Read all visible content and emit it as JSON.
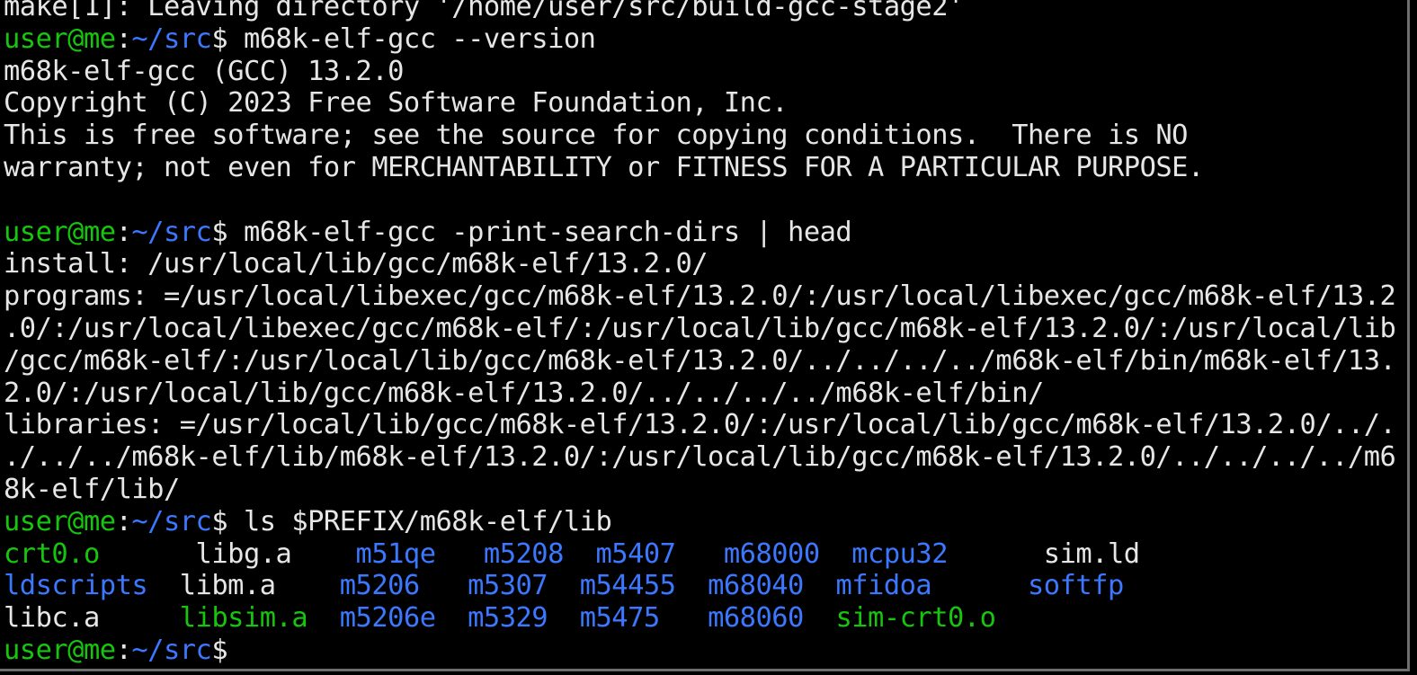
{
  "terminal": {
    "colors": {
      "foreground": "#e6e6e6",
      "background": "#000000",
      "prompt_user": "#16c60c",
      "prompt_path": "#3b78ff",
      "ls_directory": "#3b78ff",
      "ls_executable": "#16c60c"
    },
    "lines": [
      [
        [
          "make[1]: Leaving directory '/home/user/src/build-gcc-stage2'",
          "white"
        ]
      ],
      [
        [
          "user@me",
          "green"
        ],
        [
          ":",
          "white"
        ],
        [
          "~/src",
          "blue"
        ],
        [
          "$ m68k-elf-gcc --version",
          "white"
        ]
      ],
      [
        [
          "m68k-elf-gcc (GCC) 13.2.0",
          "white"
        ]
      ],
      [
        [
          "Copyright (C) 2023 Free Software Foundation, Inc.",
          "white"
        ]
      ],
      [
        [
          "This is free software; see the source for copying conditions.  There is NO",
          "white"
        ]
      ],
      [
        [
          "warranty; not even for MERCHANTABILITY or FITNESS FOR A PARTICULAR PURPOSE.",
          "white"
        ]
      ],
      [
        [
          "",
          "white"
        ]
      ],
      [
        [
          "user@me",
          "green"
        ],
        [
          ":",
          "white"
        ],
        [
          "~/src",
          "blue"
        ],
        [
          "$ m68k-elf-gcc -print-search-dirs | head",
          "white"
        ]
      ],
      [
        [
          "install: /usr/local/lib/gcc/m68k-elf/13.2.0/",
          "white"
        ]
      ],
      [
        [
          "programs: =/usr/local/libexec/gcc/m68k-elf/13.2.0/:/usr/local/libexec/gcc/m68k-elf/13.2",
          "white"
        ]
      ],
      [
        [
          ".0/:/usr/local/libexec/gcc/m68k-elf/:/usr/local/lib/gcc/m68k-elf/13.2.0/:/usr/local/lib",
          "white"
        ]
      ],
      [
        [
          "/gcc/m68k-elf/:/usr/local/lib/gcc/m68k-elf/13.2.0/../../../../m68k-elf/bin/m68k-elf/13.",
          "white"
        ]
      ],
      [
        [
          "2.0/:/usr/local/lib/gcc/m68k-elf/13.2.0/../../../../m68k-elf/bin/",
          "white"
        ]
      ],
      [
        [
          "libraries: =/usr/local/lib/gcc/m68k-elf/13.2.0/:/usr/local/lib/gcc/m68k-elf/13.2.0/../.",
          "white"
        ]
      ],
      [
        [
          "./../../m68k-elf/lib/m68k-elf/13.2.0/:/usr/local/lib/gcc/m68k-elf/13.2.0/../../../../m6",
          "white"
        ]
      ],
      [
        [
          "8k-elf/lib/",
          "white"
        ]
      ],
      [
        [
          "user@me",
          "green"
        ],
        [
          ":",
          "white"
        ],
        [
          "~/src",
          "blue"
        ],
        [
          "$ ls $PREFIX/m68k-elf/lib",
          "white"
        ]
      ],
      [
        [
          "crt0.o     ",
          "green"
        ],
        [
          " libg.a    ",
          "white"
        ],
        [
          "m51qe   ",
          "blue"
        ],
        [
          "m5208  ",
          "blue"
        ],
        [
          "m5407   ",
          "blue"
        ],
        [
          "m68000  ",
          "blue"
        ],
        [
          "mcpu32      ",
          "blue"
        ],
        [
          "sim.ld",
          "white"
        ]
      ],
      [
        [
          "ldscripts  ",
          "blue"
        ],
        [
          "libm.a    ",
          "white"
        ],
        [
          "m5206   ",
          "blue"
        ],
        [
          "m5307  ",
          "blue"
        ],
        [
          "m54455  ",
          "blue"
        ],
        [
          "m68040  ",
          "blue"
        ],
        [
          "mfidoa      ",
          "blue"
        ],
        [
          "softfp",
          "blue"
        ]
      ],
      [
        [
          "libc.a     ",
          "white"
        ],
        [
          "libsim.a  ",
          "green"
        ],
        [
          "m5206e  ",
          "blue"
        ],
        [
          "m5329  ",
          "blue"
        ],
        [
          "m5475   ",
          "blue"
        ],
        [
          "m68060  ",
          "blue"
        ],
        [
          "sim-crt0.o",
          "green"
        ]
      ],
      [
        [
          "user@me",
          "green"
        ],
        [
          ":",
          "white"
        ],
        [
          "~/src",
          "blue"
        ],
        [
          "$ ",
          "white"
        ]
      ]
    ]
  }
}
